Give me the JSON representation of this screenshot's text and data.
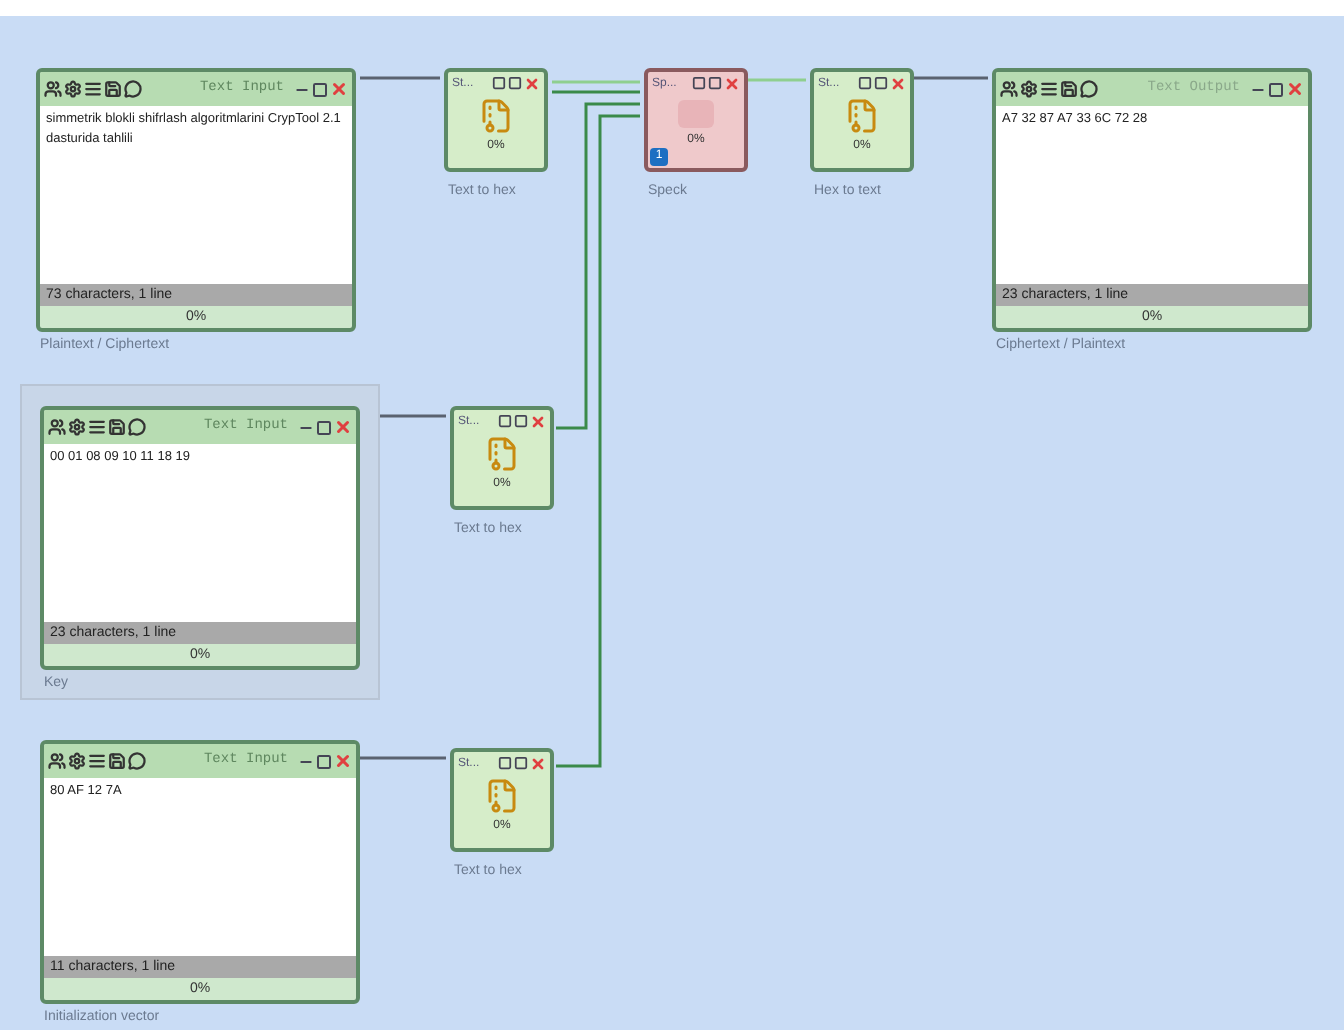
{
  "big_nodes": [
    {
      "kind": "input",
      "title": "Text Input",
      "content": "simmetrik blokli shifrlash algoritmlarini CrypTool 2.1 dasturida tahlili",
      "status": "73 characters,  1 line",
      "progress": "0%",
      "caption": "Plaintext / Ciphertext",
      "selected": false
    },
    {
      "kind": "output",
      "title": "Text Output",
      "content": "A7 32 87 A7 33 6C 72 28",
      "status": "23 characters,  1 line",
      "progress": "0%",
      "caption": "Ciphertext / Plaintext",
      "selected": false
    },
    {
      "kind": "input",
      "title": "Text Input",
      "content": "00 01 08 09 10 11 18 19",
      "status": "23 characters,  1 line",
      "progress": "0%",
      "caption": "Key",
      "selected": true
    },
    {
      "kind": "input",
      "title": "Text Input",
      "content": "80 AF 12 7A",
      "status": "11 characters,  1 line",
      "progress": "0%",
      "caption": "Initialization vector",
      "selected": false
    }
  ],
  "small_nodes": [
    {
      "kind": "converter",
      "title": "St...",
      "progress": "0%",
      "caption": "Text to hex"
    },
    {
      "kind": "cipher",
      "title": "Sp...",
      "progress": "0%",
      "caption": "Speck",
      "badge": "1"
    },
    {
      "kind": "converter",
      "title": "St...",
      "progress": "0%",
      "caption": "Hex to text"
    },
    {
      "kind": "converter",
      "title": "St...",
      "progress": "0%",
      "caption": "Text to hex"
    },
    {
      "kind": "converter",
      "title": "St...",
      "progress": "0%",
      "caption": "Text to hex"
    }
  ]
}
